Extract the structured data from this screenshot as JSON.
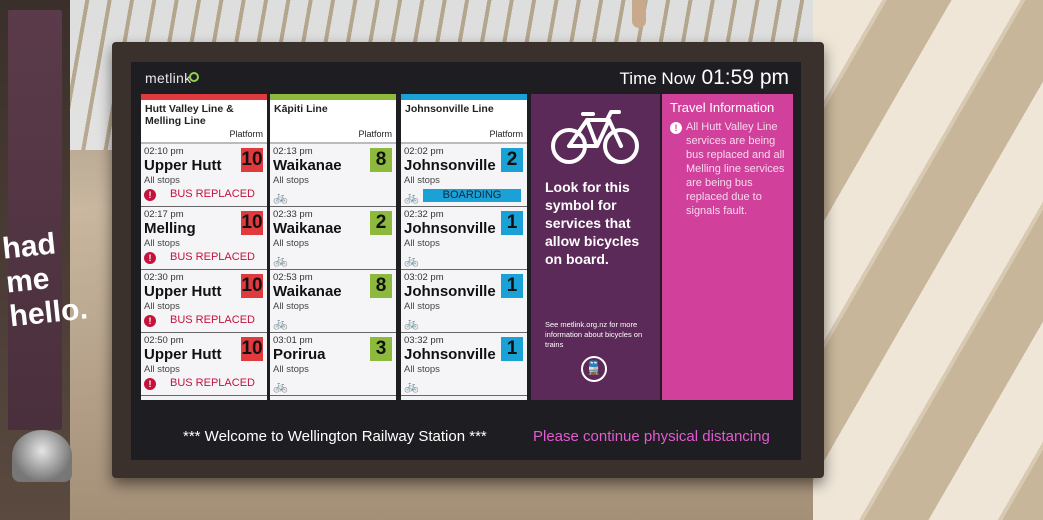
{
  "logo": "metlink",
  "time_label": "Time Now",
  "time_value": "01:59 pm",
  "columns": [
    {
      "line": "Hutt Valley Line & Melling Line",
      "platform_label": "Platform",
      "stripe": "#e0393e",
      "services": [
        {
          "time": "02:10 pm",
          "destination": "Upper Hutt",
          "stops": "All stops",
          "platform": "10",
          "platform_color": "#e0393e",
          "status": "BUS REPLACED"
        },
        {
          "time": "02:17 pm",
          "destination": "Melling",
          "stops": "All stops",
          "platform": "10",
          "platform_color": "#e0393e",
          "status": "BUS REPLACED"
        },
        {
          "time": "02:30 pm",
          "destination": "Upper Hutt",
          "stops": "All stops",
          "platform": "10",
          "platform_color": "#e0393e",
          "status": "BUS REPLACED"
        },
        {
          "time": "02:50 pm",
          "destination": "Upper Hutt",
          "stops": "All stops",
          "platform": "10",
          "platform_color": "#e0393e",
          "status": "BUS REPLACED"
        }
      ]
    },
    {
      "line": "Kāpiti Line",
      "platform_label": "Platform",
      "stripe": "#8dba3c",
      "services": [
        {
          "time": "02:13 pm",
          "destination": "Waikanae",
          "stops": "All stops",
          "platform": "8",
          "platform_color": "#8dba3c"
        },
        {
          "time": "02:33 pm",
          "destination": "Waikanae",
          "stops": "All stops",
          "platform": "2",
          "platform_color": "#8dba3c"
        },
        {
          "time": "02:53 pm",
          "destination": "Waikanae",
          "stops": "All stops",
          "platform": "8",
          "platform_color": "#8dba3c"
        },
        {
          "time": "03:01 pm",
          "destination": "Porirua",
          "stops": "All stops",
          "platform": "3",
          "platform_color": "#8dba3c"
        }
      ]
    },
    {
      "line": "Johnsonville Line",
      "platform_label": "Platform",
      "stripe": "#1aa1d6",
      "services": [
        {
          "time": "02:02 pm",
          "destination": "Johnsonville",
          "stops": "All stops",
          "platform": "2",
          "platform_color": "#1aa1d6",
          "status": "BOARDING"
        },
        {
          "time": "02:32 pm",
          "destination": "Johnsonville",
          "stops": "All stops",
          "platform": "1",
          "platform_color": "#1aa1d6"
        },
        {
          "time": "03:02 pm",
          "destination": "Johnsonville",
          "stops": "All stops",
          "platform": "1",
          "platform_color": "#1aa1d6"
        },
        {
          "time": "03:32 pm",
          "destination": "Johnsonville",
          "stops": "All stops",
          "platform": "1",
          "platform_color": "#1aa1d6"
        }
      ]
    }
  ],
  "bike_panel": {
    "headline": "Look for this symbol for services that allow bicycles on board.",
    "small_text": "See metlink.org.nz for more information about bicycles on trains",
    "icon": "bicycle-icon"
  },
  "travel_info": {
    "title": "Travel Information",
    "message": "All Hutt Valley Line services are being bus replaced and all Melling line services are being bus replaced due to signals fault."
  },
  "ticker": {
    "welcome": "***  Welcome to Wellington Railway Station  ***",
    "notice": "Please continue physical distancing"
  },
  "background_sign": "had me hello."
}
